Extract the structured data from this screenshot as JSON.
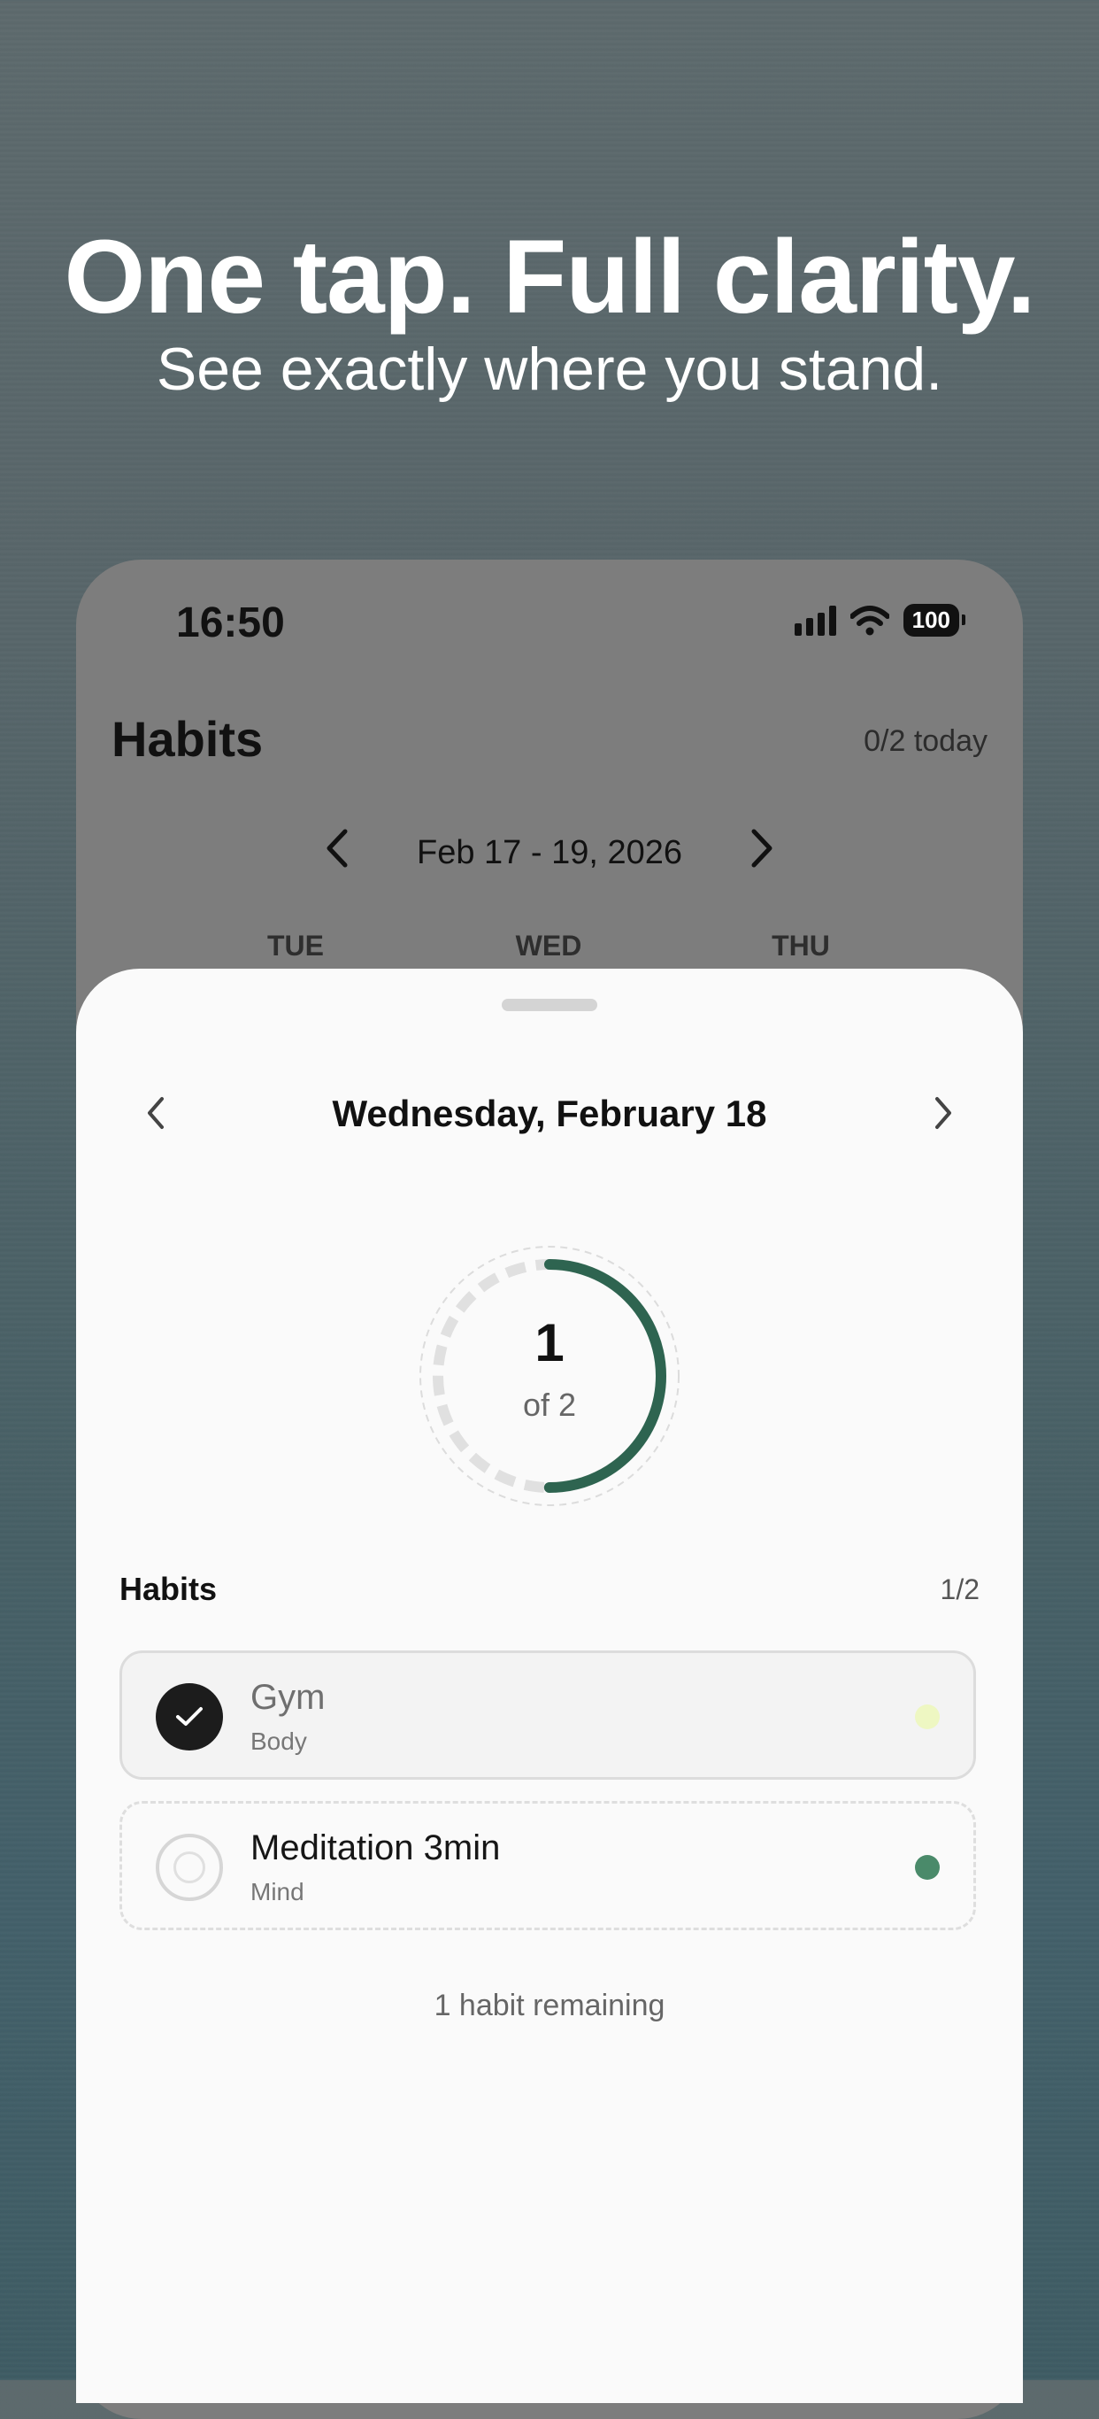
{
  "marketing": {
    "headline": "One tap. Full clarity.",
    "subheadline": "See exactly where you stand."
  },
  "status_bar": {
    "time": "16:50",
    "battery": "100",
    "icons": [
      "signal-icon",
      "wifi-icon",
      "battery-icon"
    ]
  },
  "background_screen": {
    "title": "Habits",
    "today_summary": "0/2 today",
    "week_range": "Feb 17 - 19, 2026",
    "day_names": [
      "TUE",
      "WED",
      "THU"
    ]
  },
  "sheet": {
    "date_title": "Wednesday, February 18",
    "progress": {
      "done": 1,
      "total": 2,
      "done_text": "1",
      "of_text": "of 2"
    },
    "section_title": "Habits",
    "section_count": "1/2",
    "habits": [
      {
        "name": "Gym",
        "category": "Body",
        "completed": true,
        "color": "#eef7c2"
      },
      {
        "name": "Meditation 3min",
        "category": "Mind",
        "completed": false,
        "color": "#4a8a6a"
      }
    ],
    "remaining_text": "1 habit remaining"
  },
  "colors": {
    "accent": "#2e6450",
    "sheet_bg": "#fafafa",
    "dim_overlay": "#7d7d7d"
  }
}
